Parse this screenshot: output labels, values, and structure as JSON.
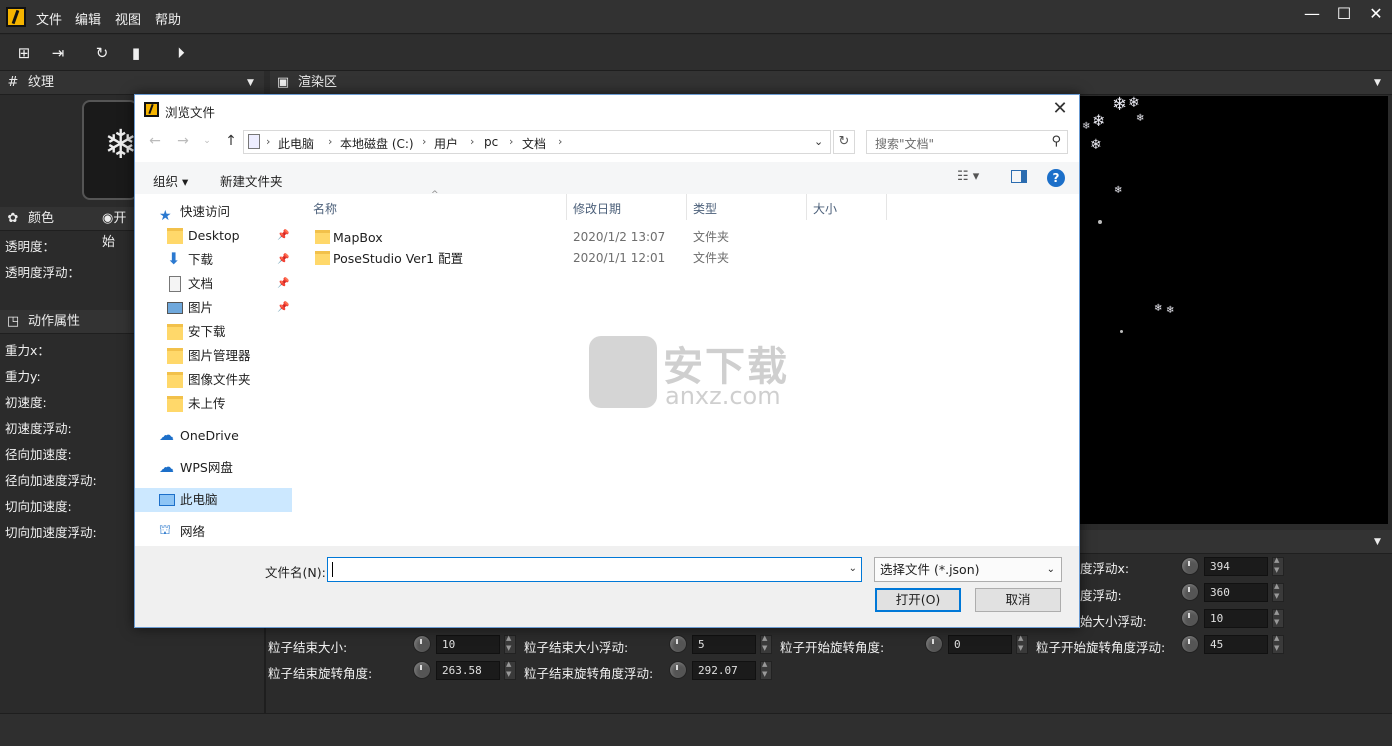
{
  "menubar": {
    "items": [
      "文件",
      "编辑",
      "视图",
      "帮助"
    ]
  },
  "window_controls": {
    "minimize": "—",
    "maximize": "☐",
    "close": "✕"
  },
  "texture_panel": {
    "title": "纹理"
  },
  "render_panel": {
    "title": "渲染区"
  },
  "color_panel": {
    "title": "颜色",
    "radio": "开始",
    "labels": [
      "透明度：",
      "透明度浮动："
    ]
  },
  "action_panel": {
    "title": "动作属性",
    "labels": [
      "重力x：",
      "重力y:",
      "初速度:",
      "初速度浮动:",
      "径向加速度:",
      "径向加速度浮动:",
      "切向加速度:",
      "切向加速度浮动:"
    ]
  },
  "params": {
    "row1": {
      "label_tail": "度浮动x:",
      "value": "394"
    },
    "row2": {
      "label_tail": "度浮动:",
      "value": "360"
    },
    "row3": {
      "label_tail": "始大小浮动:",
      "value": "10"
    },
    "row4": [
      {
        "label": "粒子结束大小:",
        "value": "10"
      },
      {
        "label": "粒子结束大小浮动:",
        "value": "5"
      },
      {
        "label": "粒子开始旋转角度:",
        "value": "0"
      },
      {
        "label": "粒子开始旋转角度浮动:",
        "value": "45"
      }
    ],
    "row5": [
      {
        "label": "粒子结束旋转角度:",
        "value": "263.58"
      },
      {
        "label": "粒子结束旋转角度浮动:",
        "value": "292.07"
      }
    ]
  },
  "dialog": {
    "title": "浏览文件",
    "breadcrumb": [
      "此电脑",
      "本地磁盘 (C:)",
      "用户",
      "pc",
      "文档"
    ],
    "search_placeholder": "搜索\"文档\"",
    "commands": {
      "organize": "组织 ▾",
      "new_folder": "新建文件夹"
    },
    "nav": {
      "quick_access": "快速访问",
      "items": [
        {
          "label": "Desktop",
          "pinned": true
        },
        {
          "label": "下载",
          "pinned": true
        },
        {
          "label": "文档",
          "pinned": true
        },
        {
          "label": "图片",
          "pinned": true
        },
        {
          "label": "安下载",
          "pinned": false
        },
        {
          "label": "图片管理器",
          "pinned": false
        },
        {
          "label": "图像文件夹",
          "pinned": false
        },
        {
          "label": "未上传",
          "pinned": false
        }
      ],
      "onedrive": "OneDrive",
      "wps": "WPS网盘",
      "this_pc": "此电脑",
      "network": "网络"
    },
    "columns": {
      "name": "名称",
      "modified": "修改日期",
      "type": "类型",
      "size": "大小"
    },
    "files": [
      {
        "name": "MapBox",
        "modified": "2020/1/2 13:07",
        "type": "文件夹"
      },
      {
        "name": "PoseStudio Ver1 配置",
        "modified": "2020/1/1 12:01",
        "type": "文件夹"
      }
    ],
    "filename_label": "文件名(N):",
    "filename_value": "",
    "filetype": "选择文件 (*.json)",
    "open_button": "打开(O)",
    "cancel_button": "取消"
  },
  "watermark": {
    "text_cn": "安下载",
    "text_en": "anxz.com"
  }
}
